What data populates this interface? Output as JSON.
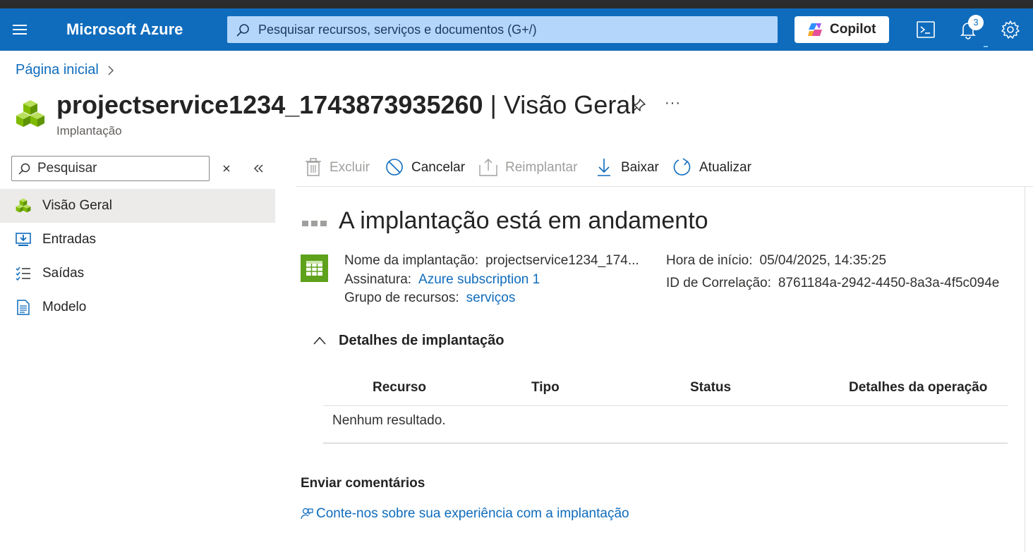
{
  "header": {
    "brand": "Microsoft Azure",
    "search_placeholder": "Pesquisar recursos, serviços e documentos (G+/)",
    "copilot_label": "Copilot",
    "notification_count": "3"
  },
  "breadcrumb": {
    "home": "Página inicial"
  },
  "page": {
    "title_name": "projectservice1234_1743873935260",
    "title_section": " | Visão Geral",
    "subtitle": "Implantação",
    "more_label": "···"
  },
  "nav": {
    "search_placeholder": "Pesquisar",
    "items": [
      {
        "label": "Visão Geral",
        "icon": "cubes-icon"
      },
      {
        "label": "Entradas",
        "icon": "inputs-icon"
      },
      {
        "label": "Saídas",
        "icon": "outputs-list-icon"
      },
      {
        "label": "Modelo",
        "icon": "template-document-icon"
      }
    ]
  },
  "toolbar": {
    "delete": "Excluir",
    "cancel": "Cancelar",
    "redeploy": "Reimplantar",
    "download": "Baixar",
    "refresh": "Atualizar"
  },
  "status": {
    "title": "A implantação está em andamento"
  },
  "details": {
    "deployment_name_label": "Nome da implantação:",
    "deployment_name_value": "projectservice1234_174...",
    "subscription_label": "Assinatura:",
    "subscription_value": "Azure subscription 1",
    "resource_group_label": "Grupo de recursos:",
    "resource_group_value": "serviços",
    "start_time_label": "Hora de início:",
    "start_time_value": "05/04/2025, 14:35:25",
    "correlation_label": "ID de Correlação:",
    "correlation_value": "8761184a-2942-4450-8a3a-4f5c094e"
  },
  "deployment_details": {
    "title": "Detalhes de implantação",
    "columns": [
      "Recurso",
      "Tipo",
      "Status",
      "Detalhes da operação"
    ],
    "empty_text": "Nenhum resultado."
  },
  "feedback": {
    "title": "Enviar comentários",
    "link": "Conte-nos sobre sua experiência com a implantação"
  },
  "colors": {
    "header_bg": "#0f6cbd",
    "link": "#0f6cbd",
    "deploy_icon": "#5ea11b"
  }
}
